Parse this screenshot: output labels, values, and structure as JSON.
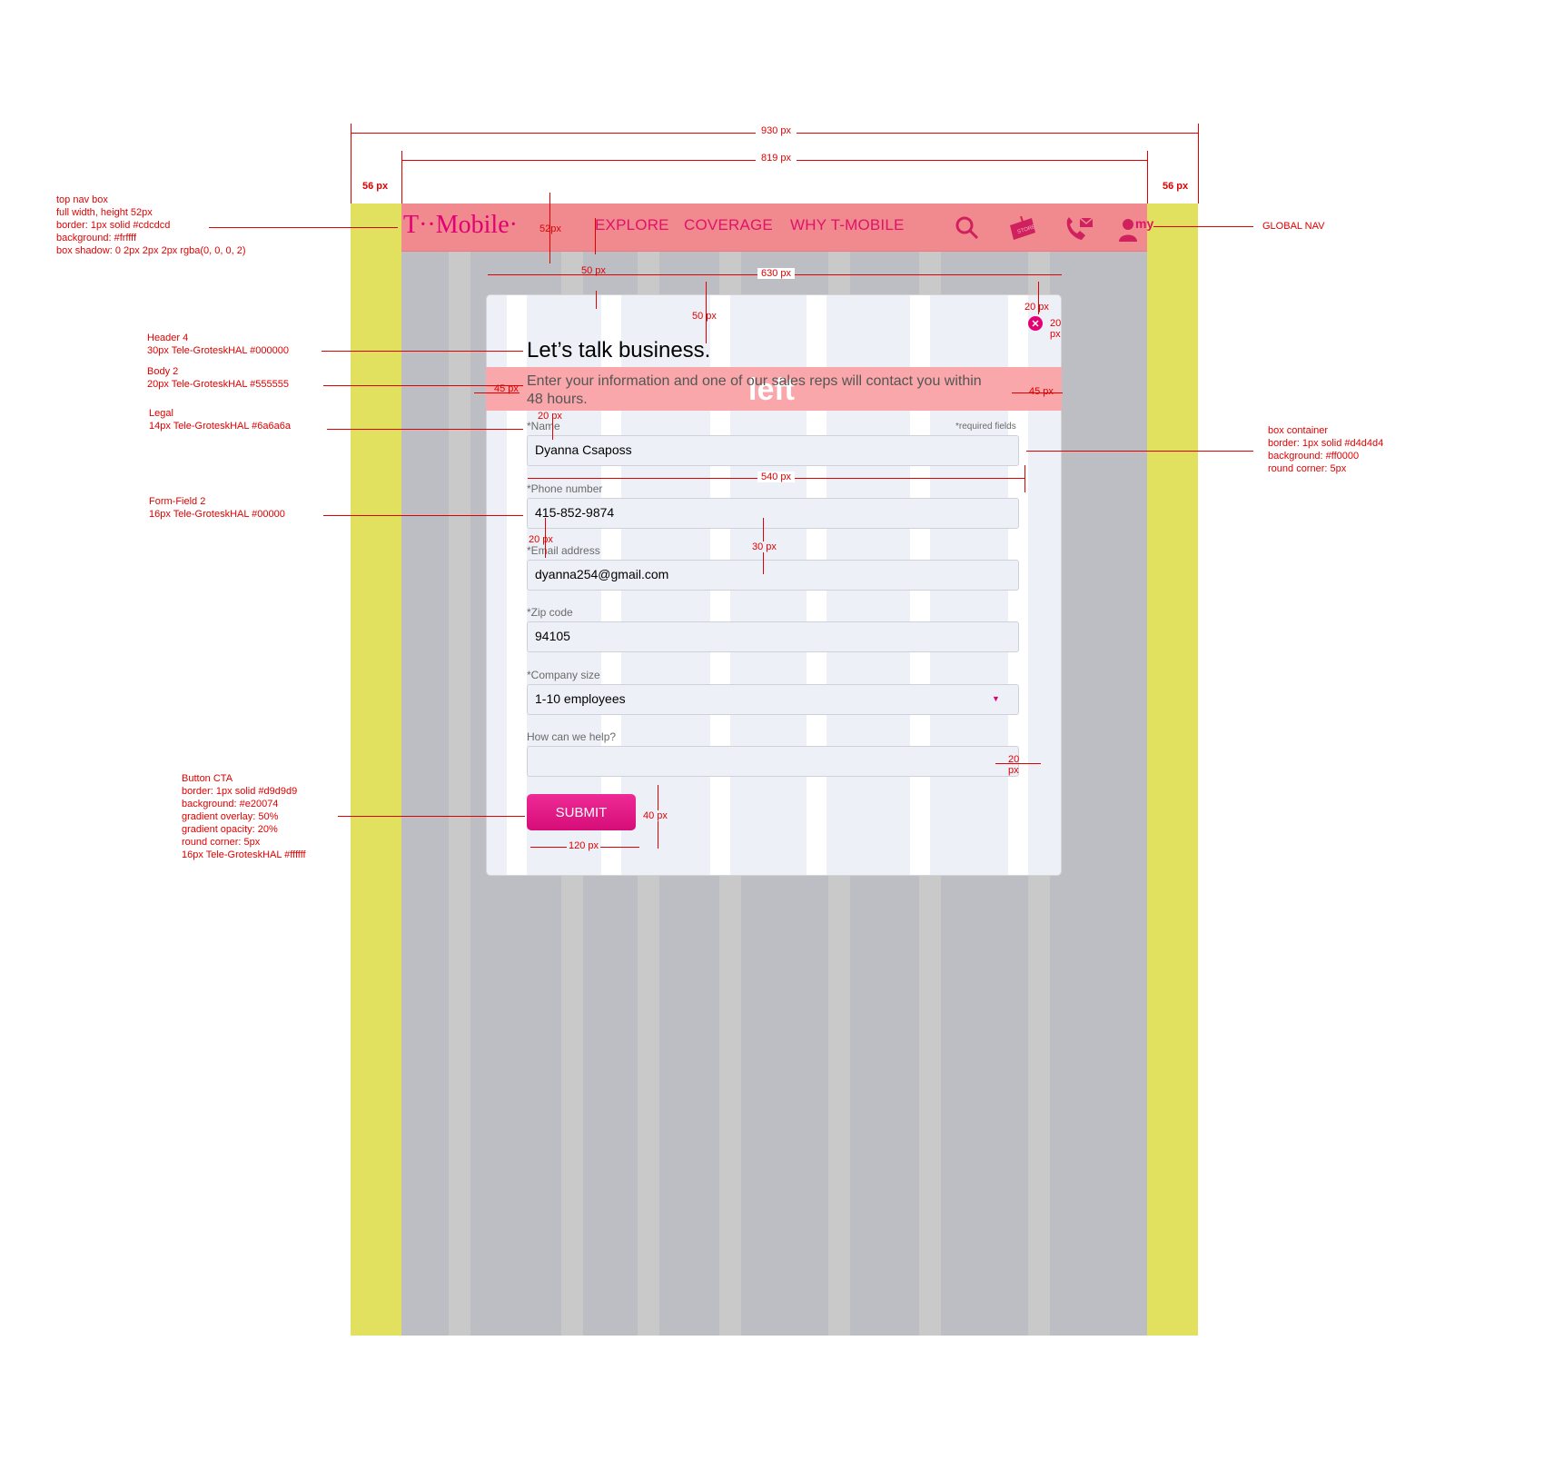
{
  "nav": {
    "logo": "T··Mobile·",
    "items": [
      "EXPLORE",
      "COVERAGE",
      "WHY T-MOBILE"
    ],
    "my_label": "my",
    "store_label": "STORE"
  },
  "form": {
    "title": "Let’s talk business.",
    "subtitle": "Enter your information and one of our sales reps will contact you within 48 hours.",
    "overlay_label": "left",
    "required_note": "*required fields",
    "fields": [
      {
        "label": "*Name",
        "value": "Dyanna Csaposs"
      },
      {
        "label": "*Phone number",
        "value": "415-852-9874"
      },
      {
        "label": "*Email address",
        "value": "dyanna254@gmail.com"
      },
      {
        "label": "*Zip code",
        "value": "94105"
      },
      {
        "label": "*Company size",
        "value": "1-10 employees"
      },
      {
        "label": "How can we help?",
        "value": ""
      }
    ],
    "submit_label": "SUBMIT"
  },
  "annotations": {
    "nav_box": [
      "top nav box",
      "full width, height 52px",
      "border: 1px solid #cdcdcd",
      "background: #frffff",
      "box shadow: 0 2px 2px 2px rgba(0, 0, 0, 2)"
    ],
    "header4": [
      "Header 4",
      "30px Tele-GroteskHAL #000000"
    ],
    "body2": [
      "Body 2",
      "20px Tele-GroteskHAL #555555"
    ],
    "legal": [
      "Legal",
      "14px Tele-GroteskHAL #6a6a6a"
    ],
    "formfield": [
      "Form-Field 2",
      "16px Tele-GroteskHAL #00000"
    ],
    "button": [
      "Button CTA",
      "border: 1px  solid #d9d9d9",
      "background: #e20074",
      "gradient overlay: 50%",
      "gradient opacity: 20%",
      "round corner: 5px",
      "16px Tele-GroteskHAL #ffffff"
    ],
    "global_nav": "GLOBAL NAV",
    "box_container": [
      "box container",
      "border: 1px  solid #d4d4d4",
      "background: #ff0000",
      "round corner: 5px"
    ]
  },
  "measures": {
    "w930": "930 px",
    "w819": "819 px",
    "m56": "56 px",
    "h52": "52px",
    "m50a": "50 px",
    "w630": "630 px",
    "m50b": "50 px",
    "m20a": "20 px",
    "m20b": "20 px",
    "m45a": "45 px",
    "m45b": "45 px",
    "m20c": "20 px",
    "w540": "540 px",
    "m20d": "20 px",
    "m30": "30 px",
    "m20e": "20 px",
    "h40": "40 px",
    "w120": "120 px"
  }
}
